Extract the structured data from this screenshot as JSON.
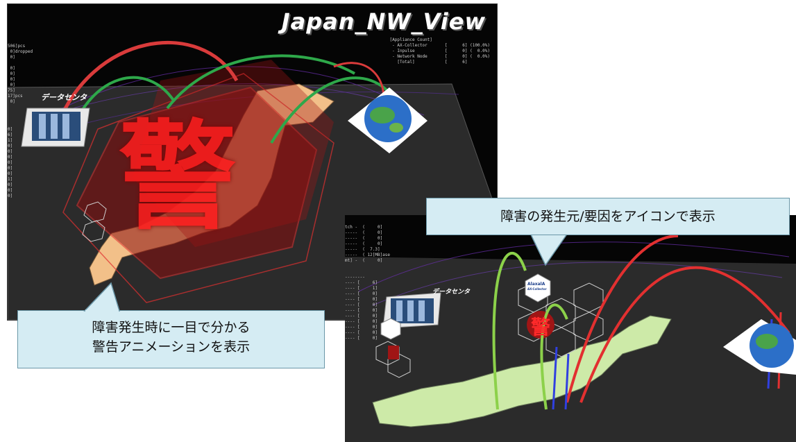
{
  "screen1": {
    "title": "Japan_NW_View",
    "data_center_label": "データセンタ",
    "alarm_glyph": "警",
    "appliance_count_text": "[Appliance Count]\n - AX-Collector       [      6] (100.0%)\n - Inpulse            [      0] (  0.0%)\n - Network Node       [      0] (  0.0%)\n   [Total]            [      6]",
    "stats_text": "506]pcs\n 0]dropped\n 0]\n\n 0]\n 0]\n 0]\n 0]\n75]\n17]pcs\n 0]\n\n\n\n\n0]\n6]\n1]\n0]\n0]\n0]\n0]\n0]\n0]\n1]\n0]\n0]\n0]"
  },
  "screen2": {
    "data_center_label": "データセンタ",
    "alarm_glyph": "警",
    "collector_badge_text": "AlaxalA",
    "collector_badge_sub": "AX-Collector",
    "stats_text": "tch -  (     0]\n-----  (     0]\n-----  (     0]\n-----  (     0]\n-----  (  7.3]\n-----  ( 12[MB]ase\nmt] -  (     0]\n\n\n--------\n---- [     6]\n---- [     1]\n---- [     0]\n---- [     0]\n---- [     0]\n---- [     0]\n---- [     0]\n---- [     0]\n---- [     0]\n---- [     0]\n---- [     0]"
  },
  "callouts": {
    "left_line1": "障害発生時に一目で分かる",
    "left_line2": "警告アニメーションを表示",
    "right": "障害の発生元/要因をアイコンで表示"
  },
  "colors": {
    "alarm_red": "#d41a1a",
    "map_land": "#f2c089",
    "map_land_green": "#cdeaa8",
    "callout_fill": "#d5ecf3",
    "callout_border": "#6a97a8"
  }
}
